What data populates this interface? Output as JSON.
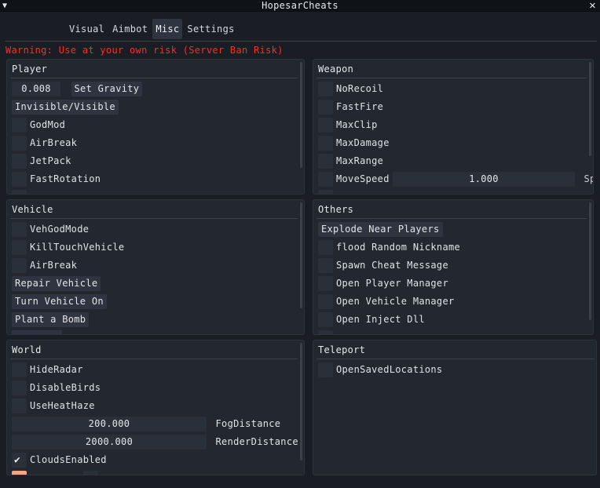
{
  "window": {
    "title": "HopesarCheats",
    "collapse_glyph": "▼",
    "close_glyph": "✕"
  },
  "tabs": [
    "Visual",
    "Aimbot",
    "Misc",
    "Settings"
  ],
  "active_tab": "Misc",
  "warning": "Warning: Use at your own risk (Server Ban Risk)",
  "colors": {
    "warning": "#ff2a2a",
    "panel_bg": "#222730",
    "window_bg": "#1a1e24",
    "widget_bg": "#2a303a",
    "button_bg": "#2e3440",
    "swatch": "#f0a48c"
  },
  "player": {
    "title": "Player",
    "gravity_value": "0.008",
    "set_gravity_label": "Set Gravity",
    "invisible_label": "Invisible/Visible",
    "toggles": [
      "GodMod",
      "AirBreak",
      "JetPack",
      "FastRotation"
    ]
  },
  "weapon": {
    "title": "Weapon",
    "toggles": [
      "NoRecoil",
      "FastFire",
      "MaxClip",
      "MaxDamage",
      "MaxRange"
    ],
    "movespeed_label": "MoveSpeed",
    "movespeed_value": "1.000",
    "movespeed_trailing": "Sp"
  },
  "vehicle": {
    "title": "Vehicle",
    "toggles": [
      "VehGodMode",
      "KillTouchVehicle",
      "AirBreak"
    ],
    "buttons": [
      "Repair Vehicle",
      "Turn Vehicle On",
      "Plant a Bomb"
    ]
  },
  "others": {
    "title": "Others",
    "explode_label": "Explode Near Players",
    "toggles": [
      "flood Random Nickname",
      "Spawn Cheat Message",
      "Open Player Manager",
      "Open Vehicle Manager",
      "Open Inject Dll"
    ]
  },
  "world": {
    "title": "World",
    "toggles": [
      "HideRadar",
      "DisableBirds",
      "UseHeatHaze"
    ],
    "fog_value": "200.000",
    "fog_label": "FogDistance",
    "render_value": "2000.000",
    "render_label": "RenderDistance",
    "clouds_label": "CloudsEnabled",
    "clouds_checked": true
  },
  "teleport": {
    "title": "Teleport",
    "toggles": [
      "OpenSavedLocations"
    ]
  }
}
